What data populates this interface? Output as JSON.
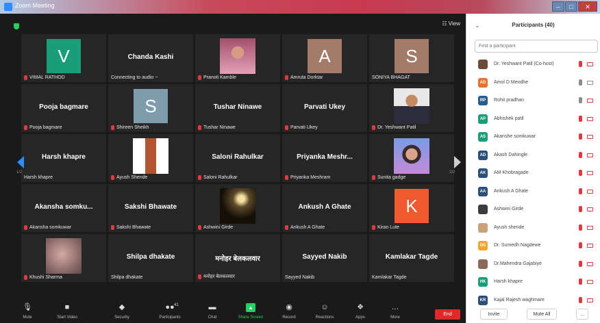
{
  "window": {
    "title": "Zoom Meeting"
  },
  "view_button": "☷ View",
  "tiles": [
    {
      "name": "",
      "caption": "VIMAL RATHOD",
      "type": "avatar",
      "letter": "V",
      "color": "#1a9e7a",
      "muted": true
    },
    {
      "name": "Chanda Kashi",
      "caption": "Connecting to audio ~",
      "type": "name",
      "muted": false
    },
    {
      "name": "",
      "caption": "Pranoti Kamble",
      "type": "photo",
      "photo": "woman-pink",
      "muted": true
    },
    {
      "name": "",
      "caption": "Amruta Dorktar",
      "type": "avatar",
      "letter": "A",
      "color": "#a37b69",
      "muted": true
    },
    {
      "name": "",
      "caption": "SONIYA BHAGAT",
      "type": "avatar",
      "letter": "S",
      "color": "#a37b69",
      "muted": false
    },
    {
      "name": "Pooja bagmare",
      "caption": "Pooja bagmare",
      "type": "name",
      "muted": true
    },
    {
      "name": "",
      "caption": "Shireen Sheikh",
      "type": "avatar",
      "letter": "S",
      "color": "#7f9cad",
      "muted": true
    },
    {
      "name": "Tushar Ninawe",
      "caption": "Tushar Ninawe",
      "type": "name",
      "muted": true
    },
    {
      "name": "Parvati Ukey",
      "caption": "Parvati Ukey",
      "type": "name",
      "muted": true
    },
    {
      "name": "",
      "caption": "Dr. Yeshwant Patil",
      "type": "photo",
      "photo": "man-suit",
      "muted": true
    },
    {
      "name": "Harsh khapre",
      "caption": "Harsh khapre",
      "type": "name",
      "muted": false
    },
    {
      "name": "",
      "caption": "Ayush Shende",
      "type": "photo",
      "photo": "book",
      "muted": true
    },
    {
      "name": "Saloni Rahulkar",
      "caption": "Saloni Rahulkar",
      "type": "name",
      "muted": true
    },
    {
      "name": "Priyanka Meshr...",
      "caption": "Priyanka Meshram",
      "type": "name",
      "muted": true
    },
    {
      "name": "",
      "caption": "Sunita gadge",
      "type": "photo",
      "photo": "woman-blue",
      "muted": true
    },
    {
      "name": "Akansha somku...",
      "caption": "Akansha somkuwar",
      "type": "name",
      "muted": true
    },
    {
      "name": "Sakshi Bhawate",
      "caption": "Sakshi Bhawate",
      "type": "name",
      "muted": true
    },
    {
      "name": "",
      "caption": "Ashwini Girde",
      "type": "photo",
      "photo": "bird",
      "muted": true
    },
    {
      "name": "Ankush A Ghate",
      "caption": "Ankush A Ghate",
      "type": "name",
      "muted": true
    },
    {
      "name": "",
      "caption": "Kiran Lute",
      "type": "avatar",
      "letter": "K",
      "color": "#f0582e",
      "muted": true
    },
    {
      "name": "",
      "caption": "Khushi Sharma",
      "type": "photo",
      "photo": "blur",
      "muted": true
    },
    {
      "name": "Shilpa dhakate",
      "caption": "Shilpa dhakate",
      "type": "name",
      "muted": false
    },
    {
      "name": "मनोहर बेलकलवार",
      "caption": "मनोहर बेलकलवार",
      "type": "name",
      "muted": true
    },
    {
      "name": "Sayyed Nakib",
      "caption": "Sayyed Nakib",
      "type": "name",
      "muted": false
    },
    {
      "name": "Kamlakar Tagde",
      "caption": "Kamlakar Tagde",
      "type": "name",
      "muted": false
    }
  ],
  "pages": {
    "left": "1/2",
    "right": "2/2"
  },
  "toolbar": {
    "items": [
      {
        "label": "Mute",
        "icon": "🎙"
      },
      {
        "label": "Start Video",
        "icon": "■"
      },
      {
        "label": "Security",
        "icon": "◆"
      },
      {
        "label": "Participants",
        "icon": "●●",
        "count": "41"
      },
      {
        "label": "Chat",
        "icon": "▬"
      },
      {
        "label": "Share Screen",
        "icon": "▲"
      },
      {
        "label": "Record",
        "icon": "◉"
      },
      {
        "label": "Reactions",
        "icon": "☺"
      },
      {
        "label": "Apps",
        "icon": "❖"
      },
      {
        "label": "More",
        "icon": "…"
      }
    ],
    "end": "End"
  },
  "panel": {
    "title": "Participants (40)",
    "search_placeholder": "Find a participant",
    "participants": [
      {
        "name": "Dr. Yeshwant Patil (Co-host)",
        "initials": "",
        "color": "#6b4b3a",
        "mic": "muted",
        "cam": "off"
      },
      {
        "name": "Amol  D Mendhe",
        "initials": "AD",
        "color": "#e8712b",
        "mic": "on",
        "cam": "on"
      },
      {
        "name": "Rohit  pradhan",
        "initials": "RP",
        "color": "#2a5b8e",
        "mic": "on",
        "cam": "off"
      },
      {
        "name": "Abhishek patil",
        "initials": "AP",
        "color": "#1a9e7a",
        "mic": "muted",
        "cam": "off"
      },
      {
        "name": "Akanshe  somkuwar",
        "initials": "AS",
        "color": "#1a9e7a",
        "mic": "muted",
        "cam": "off"
      },
      {
        "name": "Akash Dahingle",
        "initials": "AD",
        "color": "#2a4f7a",
        "mic": "muted",
        "cam": "off"
      },
      {
        "name": "AM Khobragade",
        "initials": "AK",
        "color": "#2a4f7a",
        "mic": "muted",
        "cam": "off"
      },
      {
        "name": "Ankush A Ghate",
        "initials": "AA",
        "color": "#2a4f7a",
        "mic": "muted",
        "cam": "off"
      },
      {
        "name": "Ashwini Girde",
        "initials": "",
        "color": "#3b3b3b",
        "mic": "muted",
        "cam": "off"
      },
      {
        "name": "Ayush shende",
        "initials": "",
        "color": "#c9a27a",
        "mic": "muted",
        "cam": "off"
      },
      {
        "name": "Dr. Sumedh Nagdewe",
        "initials": "DS",
        "color": "#f0a52e",
        "mic": "muted",
        "cam": "off"
      },
      {
        "name": "Dr.Mahendra Gajabiye",
        "initials": "",
        "color": "#8a6a5a",
        "mic": "muted",
        "cam": "off"
      },
      {
        "name": "Harsh khapre",
        "initials": "HK",
        "color": "#1a9e7a",
        "mic": "muted",
        "cam": "off"
      },
      {
        "name": "Kajal Rajesh waghmare",
        "initials": "KR",
        "color": "#2a4f7a",
        "mic": "muted",
        "cam": "off"
      }
    ],
    "invite": "Invite",
    "mute_all": "Mute All",
    "more": "..."
  }
}
